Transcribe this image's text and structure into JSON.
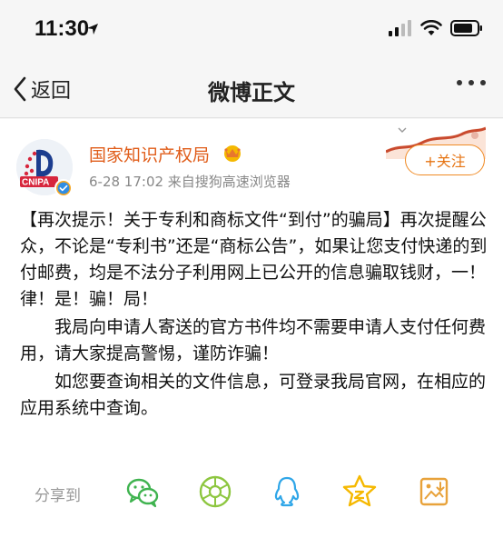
{
  "status_bar": {
    "time": "11:30"
  },
  "nav": {
    "back_label": "返回",
    "title": "微博正文"
  },
  "post": {
    "author": "国家知识产权局",
    "avatar_text": "CNIPA",
    "meta": "6-28 17:02  来自搜狗高速浏览器",
    "follow_label": "+关注",
    "paragraphs": [
      "【再次提示！关于专利和商标文件“到付”的骗局】再次提醒公众，不论是“专利书”还是“商标公告”，如果让您支付快递的到付邮费，均是不法分子利用网上已公开的信息骗取钱财，一！律！是！骗！局！",
      "我局向申请人寄送的官方书件均不需要申请人支付任何费用，请大家提高警惕，谨防诈骗！",
      "如您要查询相关的文件信息，可登录我局官网，在相应的应用系统中查询。"
    ]
  },
  "share": {
    "label": "分享到",
    "targets": [
      "wechat-icon",
      "moments-icon",
      "qq-icon",
      "qzone-icon",
      "save-image-icon"
    ]
  },
  "colors": {
    "accent": "#e67413",
    "author": "#e05d1a",
    "wechat": "#3fb34f",
    "moments": "#8dc63f",
    "qq": "#2fa6e8",
    "qzone": "#f5b800",
    "save": "#e8a23a"
  }
}
